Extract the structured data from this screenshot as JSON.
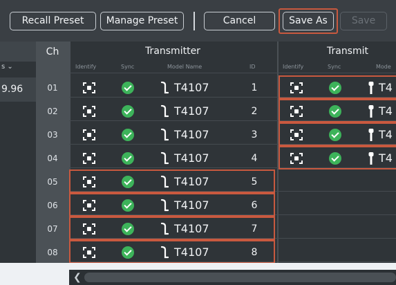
{
  "toolbar": {
    "recall_preset": "Recall Preset",
    "manage_preset": "Manage Preset",
    "cancel": "Cancel",
    "save_as": "Save As",
    "save": "Save"
  },
  "table": {
    "ch_header": "Ch",
    "group1_header": "Transmitter",
    "group2_header": "Transmit",
    "sub_identify": "Identify",
    "sub_sync": "Sync",
    "sub_model": "Model Name",
    "sub_model_trunc": "Mode",
    "sub_id": "ID",
    "left_sub": "s",
    "left_value": "9.96"
  },
  "rows": [
    {
      "ch": "01",
      "model": "T4107",
      "id": "1",
      "model2": "T4"
    },
    {
      "ch": "02",
      "model": "T4107",
      "id": "2",
      "model2": "T4"
    },
    {
      "ch": "03",
      "model": "T4107",
      "id": "3",
      "model2": "T4"
    },
    {
      "ch": "04",
      "model": "T4107",
      "id": "4",
      "model2": "T4"
    },
    {
      "ch": "05",
      "model": "T4107",
      "id": "5"
    },
    {
      "ch": "06",
      "model": "T4107",
      "id": "6"
    },
    {
      "ch": "07",
      "model": "T4107",
      "id": "7"
    },
    {
      "ch": "08",
      "model": "T4107",
      "id": "8"
    }
  ],
  "colors": {
    "highlight": "#c9593f",
    "sync_ok": "#3db35a",
    "toolbar_bg": "#3a3f44",
    "table_bg": "#2f3438"
  }
}
